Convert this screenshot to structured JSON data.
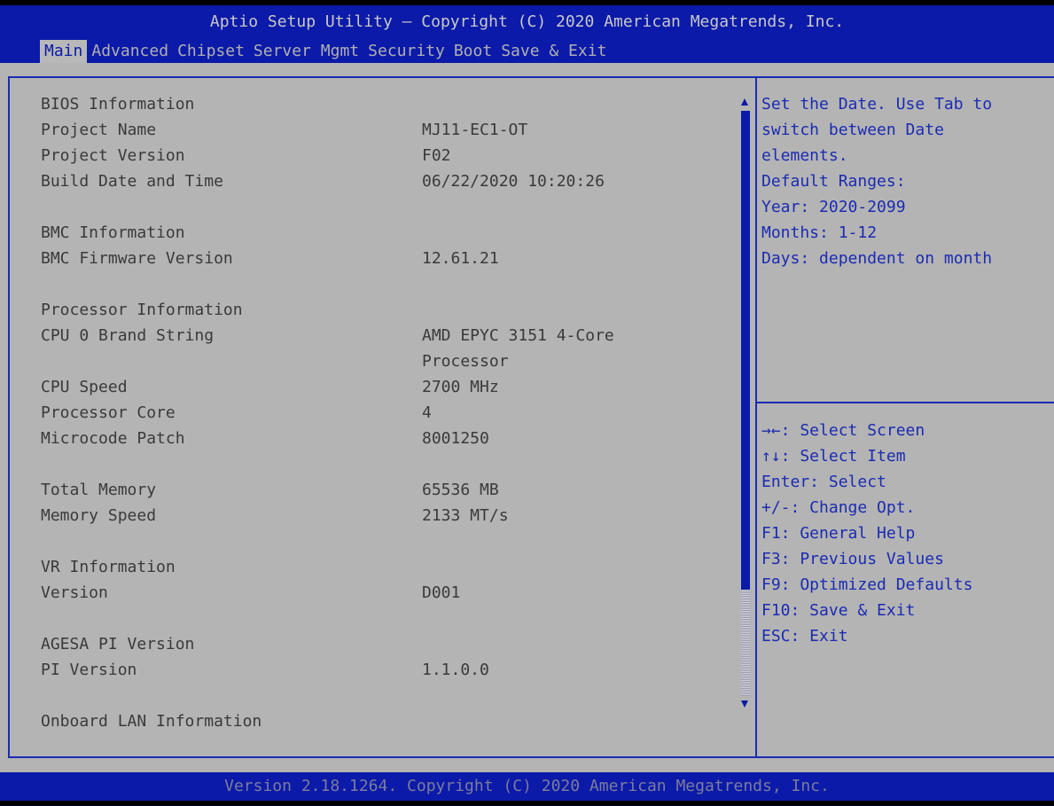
{
  "header": {
    "title": "Aptio Setup Utility – Copyright (C) 2020 American Megatrends, Inc.",
    "tabs": [
      "Main",
      "Advanced",
      "Chipset",
      "Server Mgmt",
      "Security",
      "Boot",
      "Save & Exit"
    ],
    "active_tab": "Main"
  },
  "main": {
    "rows": [
      {
        "label": "BIOS Information",
        "value": ""
      },
      {
        "label": "Project Name",
        "value": "MJ11-EC1-OT"
      },
      {
        "label": "Project Version",
        "value": "F02"
      },
      {
        "label": "Build Date and Time",
        "value": "06/22/2020 10:20:26"
      },
      {
        "label": "",
        "value": ""
      },
      {
        "label": "BMC Information",
        "value": ""
      },
      {
        "label": "BMC Firmware Version",
        "value": "12.61.21"
      },
      {
        "label": "",
        "value": ""
      },
      {
        "label": "Processor Information",
        "value": ""
      },
      {
        "label": "CPU 0 Brand String",
        "value": "AMD EPYC 3151 4-Core"
      },
      {
        "label": "",
        "value": "Processor"
      },
      {
        "label": "CPU Speed",
        "value": "2700 MHz"
      },
      {
        "label": "Processor Core",
        "value": "4"
      },
      {
        "label": "Microcode Patch",
        "value": "8001250"
      },
      {
        "label": "",
        "value": ""
      },
      {
        "label": "Total Memory",
        "value": "65536 MB"
      },
      {
        "label": "Memory Speed",
        "value": "2133 MT/s"
      },
      {
        "label": "",
        "value": ""
      },
      {
        "label": "VR Information",
        "value": ""
      },
      {
        "label": "Version",
        "value": "D001"
      },
      {
        "label": "",
        "value": ""
      },
      {
        "label": "AGESA PI Version",
        "value": ""
      },
      {
        "label": "PI Version",
        "value": "1.1.0.0"
      },
      {
        "label": "",
        "value": ""
      },
      {
        "label": "Onboard LAN Information",
        "value": ""
      }
    ]
  },
  "help": {
    "lines": [
      "Set the Date. Use Tab to",
      "switch between Date",
      "elements.",
      "Default Ranges:",
      "Year: 2020-2099",
      "Months: 1-12",
      "Days: dependent on month"
    ]
  },
  "keys": {
    "lines": [
      "→←: Select Screen",
      "↑↓: Select Item",
      "Enter: Select",
      "+/-: Change Opt.",
      "F1: General Help",
      "F3: Previous Values",
      "F9: Optimized Defaults",
      "F10: Save & Exit",
      "ESC: Exit"
    ]
  },
  "scrollbar": {
    "up_icon": "triangle-up-icon",
    "down_icon": "triangle-down-icon",
    "color": "#0b1aa8"
  },
  "footer": {
    "text": "Version 2.18.1264. Copyright (C) 2020 American Megatrends, Inc."
  },
  "colors": {
    "header_bg": "#0b1aa8",
    "body_bg": "#b4b4b4",
    "help_text": "#1b2bb2",
    "main_text": "#3a3a3a"
  }
}
